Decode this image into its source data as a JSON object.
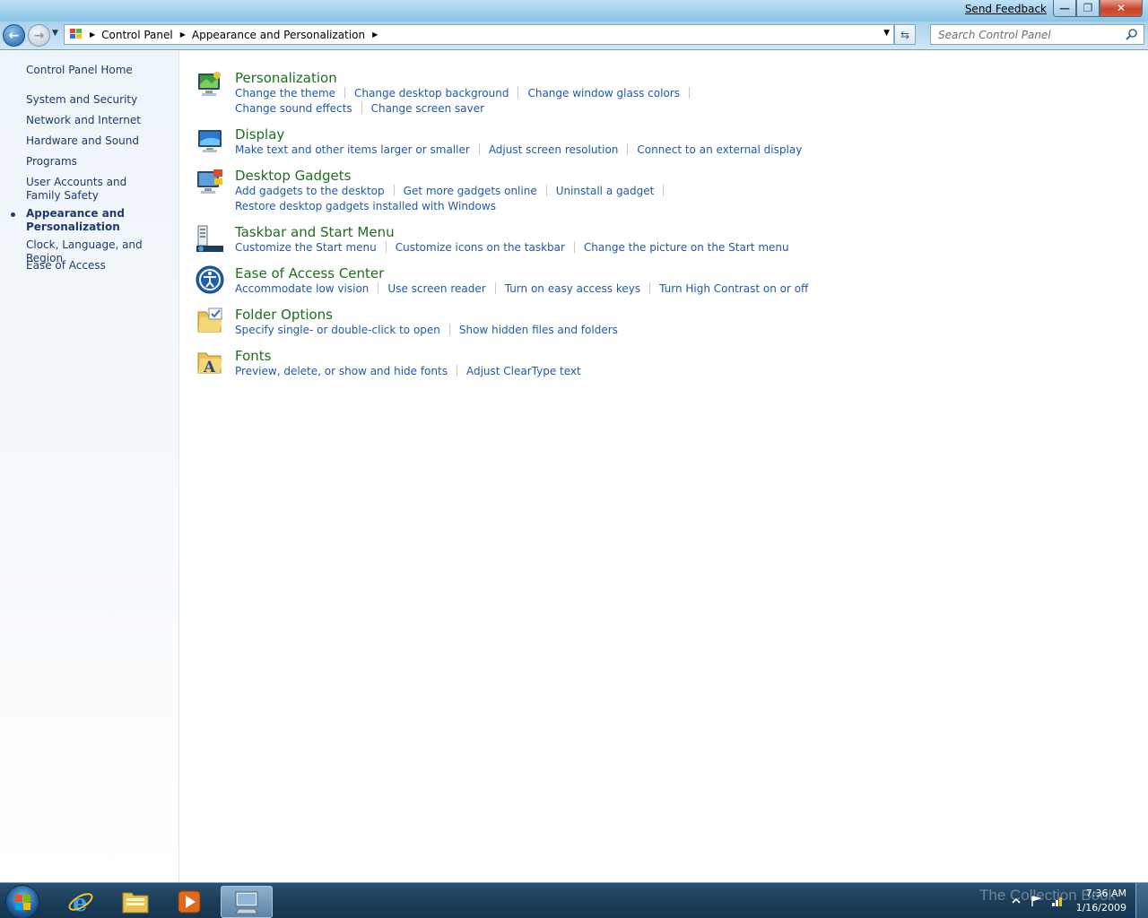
{
  "window": {
    "send_feedback": "Send Feedback",
    "minimize_glyph": "—",
    "maximize_glyph": "❐",
    "close_glyph": "✕"
  },
  "address": {
    "breadcrumbs": [
      "Control Panel",
      "Appearance and Personalization"
    ],
    "search_placeholder": "Search Control Panel"
  },
  "sidebar": {
    "home": "Control Panel Home",
    "items": [
      {
        "label": "System and Security"
      },
      {
        "label": "Network and Internet"
      },
      {
        "label": "Hardware and Sound"
      },
      {
        "label": "Programs"
      },
      {
        "label": "User Accounts and Family Safety"
      },
      {
        "label": "Appearance and Personalization",
        "current": true
      },
      {
        "label": "Clock, Language, and Region"
      },
      {
        "label": "Ease of Access"
      }
    ]
  },
  "categories": [
    {
      "title": "Personalization",
      "icon": "personalization-icon",
      "lines": [
        [
          "Change the theme",
          "Change desktop background",
          "Change window glass colors"
        ],
        [
          "Change sound effects",
          "Change screen saver"
        ]
      ]
    },
    {
      "title": "Display",
      "icon": "display-icon",
      "lines": [
        [
          "Make text and other items larger or smaller",
          "Adjust screen resolution",
          "Connect to an external display"
        ]
      ]
    },
    {
      "title": "Desktop Gadgets",
      "icon": "gadgets-icon",
      "lines": [
        [
          "Add gadgets to the desktop",
          "Get more gadgets online",
          "Uninstall a gadget"
        ],
        [
          "Restore desktop gadgets installed with Windows"
        ]
      ]
    },
    {
      "title": "Taskbar and Start Menu",
      "icon": "taskbar-icon",
      "lines": [
        [
          "Customize the Start menu",
          "Customize icons on the taskbar",
          "Change the picture on the Start menu"
        ]
      ]
    },
    {
      "title": "Ease of Access Center",
      "icon": "ease-of-access-icon",
      "lines": [
        [
          "Accommodate low vision",
          "Use screen reader",
          "Turn on easy access keys",
          "Turn High Contrast on or off"
        ]
      ]
    },
    {
      "title": "Folder Options",
      "icon": "folder-options-icon",
      "lines": [
        [
          "Specify single- or double-click to open",
          "Show hidden files and folders"
        ]
      ]
    },
    {
      "title": "Fonts",
      "icon": "fonts-icon",
      "lines": [
        [
          "Preview, delete, or show and hide fonts",
          "Adjust ClearType text"
        ]
      ]
    }
  ],
  "taskbar": {
    "apps": [
      "internet-explorer-icon",
      "windows-explorer-icon",
      "media-player-icon",
      "control-panel-icon"
    ],
    "watermark": "The Collection Book",
    "time": "7:36 AM",
    "date": "1/16/2009"
  },
  "colors": {
    "link": "#1f5aa8",
    "category_title": "#1e6e1e",
    "sidebar_text": "#1e3a6b"
  }
}
